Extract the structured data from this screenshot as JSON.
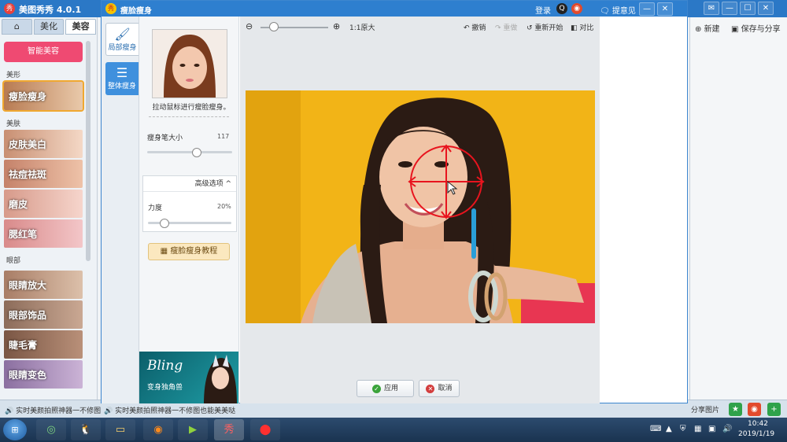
{
  "app": {
    "title": "美图秀秀 4.0.1",
    "window_controls": {
      "minimize": "—",
      "restore": "☐",
      "close": "✕"
    }
  },
  "left_panel": {
    "tabs": [
      {
        "label": "⌂"
      },
      {
        "label": "美化"
      },
      {
        "label": "美容"
      }
    ],
    "smart_beauty_label": "智能美容",
    "sections": [
      {
        "title": "美形",
        "items": [
          {
            "label": "瘦脸瘦身"
          }
        ]
      },
      {
        "title": "美肤",
        "items": [
          {
            "label": "皮肤美白"
          },
          {
            "label": "祛痘祛斑"
          },
          {
            "label": "磨皮"
          },
          {
            "label": "腮红笔"
          }
        ]
      },
      {
        "title": "眼部",
        "items": [
          {
            "label": "眼睛放大"
          },
          {
            "label": "眼部饰品"
          },
          {
            "label": "睫毛膏"
          },
          {
            "label": "眼睛变色"
          }
        ]
      }
    ]
  },
  "right_panel": {
    "new_label": "新建",
    "save_share_label": "保存与分享",
    "share_image_label": "分享图片"
  },
  "status_bar": {
    "news_left": "实时美颜拍照神器一不修图",
    "news_mid": "实时美颜拍照神器一不修图也能美美哒"
  },
  "dialog": {
    "title": "瘦脸瘦身",
    "login_label": "登录",
    "feedback_label": "提意见",
    "vtabs": [
      {
        "label": "局部瘦身"
      },
      {
        "label": "整体瘦身"
      }
    ],
    "hint": "拉动鼠标进行瘦脸瘦身。",
    "brush_size": {
      "label": "瘦身笔大小",
      "value_text": "117",
      "value": 117,
      "max": 200
    },
    "advanced_label": "高级选项",
    "strength": {
      "label": "力度",
      "value_text": "20%",
      "value": 0.2
    },
    "tutorial_label": "瘦脸瘦身教程",
    "ad": {
      "line1": "Bling",
      "line2": "变身独角兽"
    },
    "toolbar": {
      "zoom_level": 0.2,
      "original_size_label": "1:1原大",
      "undo_label": "撤销",
      "redo_label": "重做",
      "restart_label": "重新开始",
      "compare_label": "对比"
    },
    "apply_label": "应用",
    "cancel_label": "取消"
  },
  "taskbar": {
    "clock_time": "10:42",
    "clock_date": "2019/1/19"
  },
  "colors": {
    "title_bar": "#2b78c6",
    "accent_pink": "#ef4a72",
    "photo_background": "#f2b417",
    "brush_circle": "#e8141e"
  }
}
